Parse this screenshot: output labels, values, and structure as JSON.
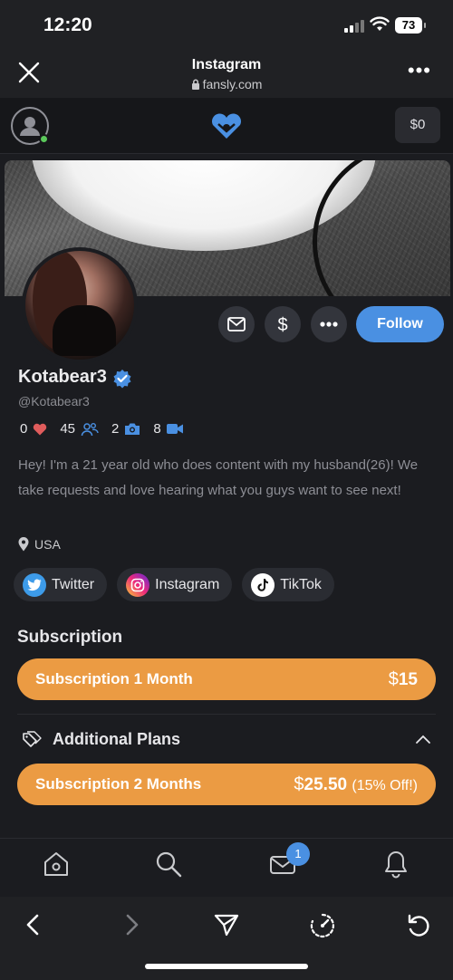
{
  "status": {
    "time": "12:20",
    "battery": "73"
  },
  "browser": {
    "title": "Instagram",
    "url": "fansly.com"
  },
  "topbar": {
    "balance": "$0"
  },
  "profile": {
    "name": "Kotabear3",
    "handle": "@Kotabear3",
    "stats": {
      "likes": "0",
      "followers": "45",
      "photos": "2",
      "videos": "8"
    },
    "bio": "Hey! I'm a 21 year old who does content with my husband(26)! We take requests and love hearing what you guys want to see next!",
    "location": "USA",
    "follow_label": "Follow"
  },
  "socials": [
    {
      "label": "Twitter",
      "icon": "twitter-icon"
    },
    {
      "label": "Instagram",
      "icon": "instagram-icon"
    },
    {
      "label": "TikTok",
      "icon": "tiktok-icon"
    }
  ],
  "subscription": {
    "title": "Subscription",
    "plan1": {
      "label": "Subscription 1 Month",
      "price": "15"
    },
    "additional_title": "Additional Plans",
    "plan2": {
      "label": "Subscription 2 Months",
      "price": "25.50",
      "discount": "(15% Off!)"
    }
  },
  "nav": {
    "messages_badge": "1"
  },
  "colors": {
    "accent": "#4a90e2",
    "plan": "#eb9b43",
    "background": "#1b1c20"
  }
}
